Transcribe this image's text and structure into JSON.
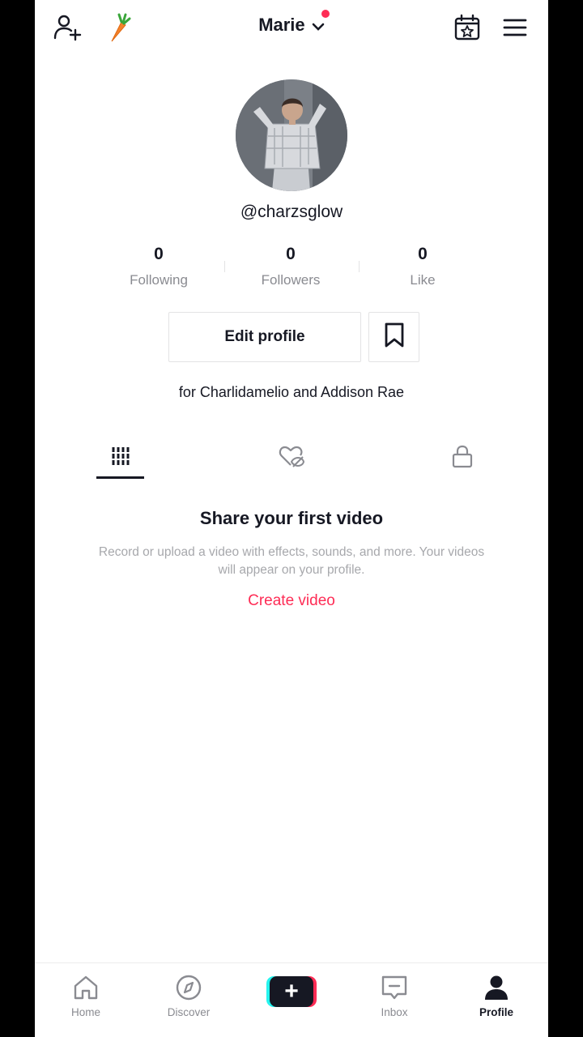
{
  "header": {
    "account_name": "Marie",
    "icons": [
      "add-user-icon",
      "carrot-icon",
      "chevron-down-icon",
      "calendar-star-icon",
      "menu-icon"
    ]
  },
  "profile": {
    "username": "@charzsglow",
    "stats": [
      {
        "value": "0",
        "label": "Following"
      },
      {
        "value": "0",
        "label": "Followers"
      },
      {
        "value": "0",
        "label": "Like"
      }
    ],
    "edit_label": "Edit profile",
    "bio": "for Charlidamelio and Addison Rae"
  },
  "tabs": [
    "videos-grid-icon",
    "liked-hidden-icon",
    "lock-icon"
  ],
  "empty_state": {
    "title": "Share your first video",
    "description": "Record or upload a video with effects, sounds, and more. Your videos will appear on your profile.",
    "action": "Create video"
  },
  "bottom_nav": {
    "home": "Home",
    "discover": "Discover",
    "create": "+",
    "inbox": "Inbox",
    "profile": "Profile"
  },
  "colors": {
    "accent": "#fe2c55",
    "secondary_accent": "#25f4ee",
    "text": "#161823",
    "muted": "#8a8b91"
  }
}
